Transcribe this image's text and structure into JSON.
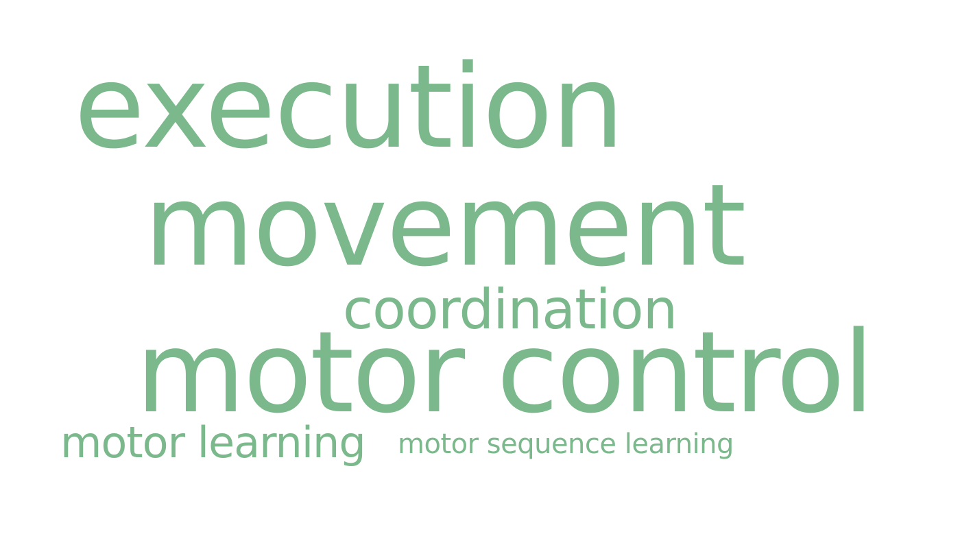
{
  "word_cloud": {
    "color": "#7bb98c",
    "words": [
      {
        "text": "execution"
      },
      {
        "text": "movement"
      },
      {
        "text": "coordination"
      },
      {
        "text": "motor control"
      },
      {
        "text": "motor learning"
      },
      {
        "text": "motor sequence learning"
      }
    ]
  }
}
